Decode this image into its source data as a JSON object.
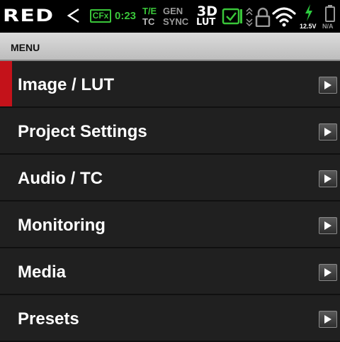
{
  "status_bar": {
    "logo": "RED",
    "cfx_label": "CFx",
    "cfx_time": "0:23",
    "te_top": "T/E",
    "te_bottom": "TC",
    "gen_top": "GEN",
    "gen_bottom": "SYNC",
    "lut_top": "3D",
    "lut_bottom": "LUT",
    "voltage": "12.5V",
    "battery_status": "N/A",
    "icons": [
      "chevron-left-icon",
      "check-box-icon",
      "scroll-indicator-icon",
      "lock-icon",
      "wifi-icon",
      "power-bolt-icon",
      "battery-icon"
    ],
    "colors": {
      "accent_green": "#3ac63a",
      "bolt_green": "#2ecc40",
      "selection_red": "#c4121a"
    }
  },
  "menu": {
    "title": "MENU",
    "items": [
      {
        "label": "Image / LUT",
        "selected": true
      },
      {
        "label": "Project Settings",
        "selected": false
      },
      {
        "label": "Audio / TC",
        "selected": false
      },
      {
        "label": "Monitoring",
        "selected": false
      },
      {
        "label": "Media",
        "selected": false
      },
      {
        "label": "Presets",
        "selected": false
      }
    ]
  }
}
